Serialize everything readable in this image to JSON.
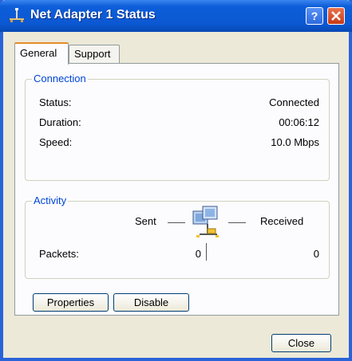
{
  "window": {
    "title": "Net Adapter 1 Status",
    "icon": "network-connection-icon",
    "help_button": "?",
    "close_glyph": "×"
  },
  "tabs": [
    {
      "label": "General",
      "active": true
    },
    {
      "label": "Support",
      "active": false
    }
  ],
  "connection": {
    "legend": "Connection",
    "rows": [
      {
        "label": "Status:",
        "value": "Connected"
      },
      {
        "label": "Duration:",
        "value": "00:06:12"
      },
      {
        "label": "Speed:",
        "value": "10.0 Mbps"
      }
    ]
  },
  "activity": {
    "legend": "Activity",
    "sent_label": "Sent",
    "received_label": "Received",
    "packets_label": "Packets:",
    "packets_sent": "0",
    "packets_received": "0",
    "icon": "network-activity-icon"
  },
  "buttons": {
    "properties": "Properties",
    "disable": "Disable",
    "close": "Close"
  },
  "colors": {
    "titlebar": "#0b58d2",
    "legend_text": "#0046d5",
    "active_tab_accent": "#e68b2c"
  }
}
